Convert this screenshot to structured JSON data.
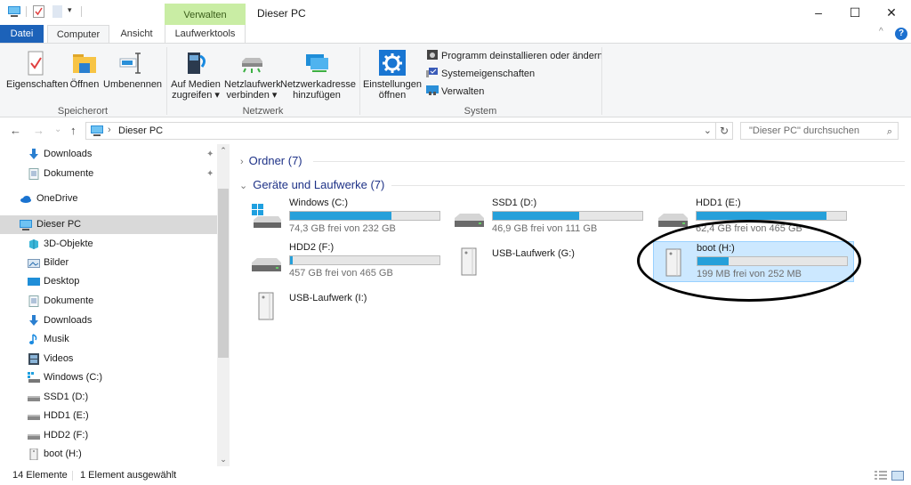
{
  "window": {
    "title": "Dieser PC",
    "context_tab_header": "Verwalten",
    "controls": {
      "minimize": "–",
      "maximize": "☐",
      "close": "✕"
    }
  },
  "ribbon": {
    "tabs": [
      {
        "label": "Datei"
      },
      {
        "label": "Computer"
      },
      {
        "label": "Ansicht"
      },
      {
        "label": "Laufwerktools"
      }
    ],
    "help": "?",
    "collapse": "^",
    "groups": {
      "speicherort": {
        "label": "Speicherort",
        "buttons": [
          {
            "label": "Eigenschaften",
            "icon": "properties-icon"
          },
          {
            "label": "Öffnen",
            "icon": "folder-open-icon"
          },
          {
            "label": "Umbenennen",
            "icon": "rename-icon"
          }
        ]
      },
      "netzwerk": {
        "label": "Netzwerk",
        "buttons": [
          {
            "line1": "Auf Medien",
            "line2": "zugreifen ▾",
            "icon": "media-access-icon"
          },
          {
            "line1": "Netzlaufwerk",
            "line2": "verbinden ▾",
            "icon": "network-drive-icon"
          },
          {
            "line1": "Netzwerkadresse",
            "line2": "hinzufügen",
            "icon": "network-location-icon"
          }
        ]
      },
      "system": {
        "label": "System",
        "big_button": {
          "line1": "Einstellungen",
          "line2": "öffnen",
          "icon": "settings-gear-icon"
        },
        "items": [
          {
            "label": "Programm deinstallieren oder ändern",
            "icon": "uninstall-icon"
          },
          {
            "label": "Systemeigenschaften",
            "icon": "system-properties-icon"
          },
          {
            "label": "Verwalten",
            "icon": "manage-icon"
          }
        ]
      }
    }
  },
  "navigation": {
    "back": "←",
    "forward": "→",
    "recent": "⌄",
    "up": "↑",
    "breadcrumb_sep": "›",
    "path": "Dieser PC",
    "dropdown": "⌄",
    "refresh": "↻",
    "search_placeholder": "\"Dieser PC\" durchsuchen",
    "search_icon": "⌕"
  },
  "sidebar": {
    "items": [
      {
        "label": "Downloads",
        "icon": "download-arrow-icon",
        "pinned": true,
        "indent": 2
      },
      {
        "label": "Dokumente",
        "icon": "document-icon",
        "pinned": true,
        "indent": 2
      },
      {
        "label": "OneDrive",
        "icon": "onedrive-cloud-icon",
        "indent": 1
      },
      {
        "label": "Dieser PC",
        "icon": "computer-icon",
        "indent": 1,
        "selected": true
      },
      {
        "label": "3D-Objekte",
        "icon": "3d-objects-icon",
        "indent": 2
      },
      {
        "label": "Bilder",
        "icon": "pictures-icon",
        "indent": 2
      },
      {
        "label": "Desktop",
        "icon": "desktop-icon",
        "indent": 2
      },
      {
        "label": "Dokumente",
        "icon": "document-icon",
        "indent": 2
      },
      {
        "label": "Downloads",
        "icon": "download-arrow-icon",
        "indent": 2
      },
      {
        "label": "Musik",
        "icon": "music-note-icon",
        "indent": 2
      },
      {
        "label": "Videos",
        "icon": "video-film-icon",
        "indent": 2
      },
      {
        "label": "Windows (C:)",
        "icon": "windows-drive-icon",
        "indent": 2
      },
      {
        "label": "SSD1 (D:)",
        "icon": "drive-icon",
        "indent": 2
      },
      {
        "label": "HDD1 (E:)",
        "icon": "drive-icon",
        "indent": 2
      },
      {
        "label": "HDD2 (F:)",
        "icon": "drive-icon",
        "indent": 2
      },
      {
        "label": "boot (H:)",
        "icon": "usb-drive-icon",
        "indent": 2
      }
    ],
    "pin_glyph": "📌"
  },
  "content": {
    "groups": [
      {
        "label": "Ordner (7)",
        "expanded": false,
        "chevron": "›"
      },
      {
        "label": "Geräte und Laufwerke (7)",
        "expanded": true,
        "chevron": "⌄"
      }
    ],
    "drives": [
      {
        "name": "Windows (C:)",
        "free": "74,3 GB frei von 232 GB",
        "used_fraction": 0.68,
        "type": "windows"
      },
      {
        "name": "SSD1 (D:)",
        "free": "46,9 GB frei von 111 GB",
        "used_fraction": 0.58,
        "type": "hdd"
      },
      {
        "name": "HDD1 (E:)",
        "free": "62,4 GB frei von 465 GB",
        "used_fraction": 0.87,
        "type": "hdd"
      },
      {
        "name": "HDD2 (F:)",
        "free": "457 GB frei von 465 GB",
        "used_fraction": 0.02,
        "type": "hdd"
      },
      {
        "name": "USB-Laufwerk (G:)",
        "free": "",
        "used_fraction": null,
        "type": "usb"
      },
      {
        "name": "boot (H:)",
        "free": "199 MB frei von 252 MB",
        "used_fraction": 0.21,
        "type": "usb",
        "selected": true
      },
      {
        "name": "USB-Laufwerk (I:)",
        "free": "",
        "used_fraction": null,
        "type": "usb"
      }
    ]
  },
  "status": {
    "count": "14 Elemente",
    "selection": "1 Element ausgewählt"
  }
}
